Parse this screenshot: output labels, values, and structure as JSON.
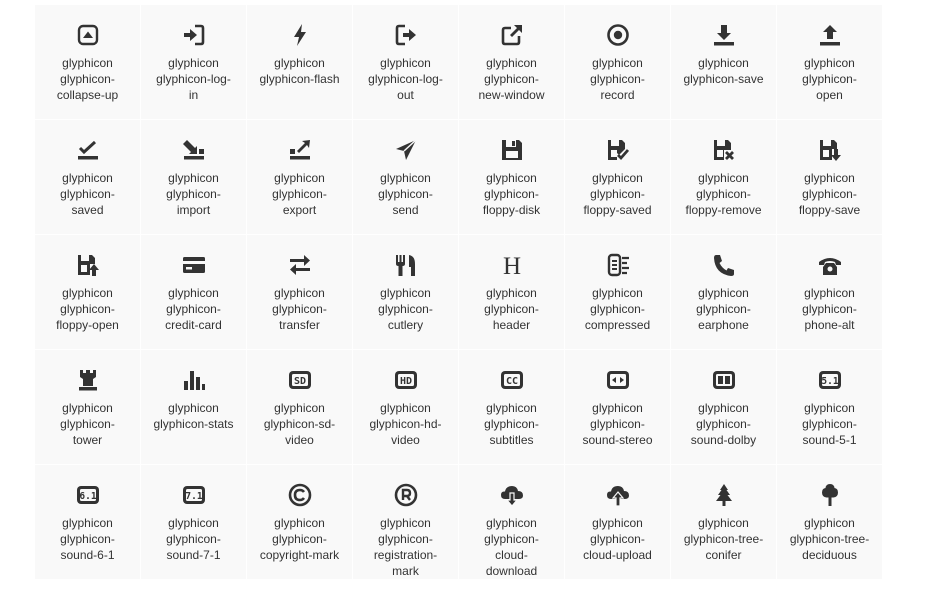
{
  "icons": [
    {
      "name": "collapse-up-icon",
      "lines": [
        "glyphicon",
        "glyphicon-",
        "collapse-up"
      ]
    },
    {
      "name": "log-in-icon",
      "lines": [
        "glyphicon",
        "glyphicon-log-",
        "in"
      ]
    },
    {
      "name": "flash-icon",
      "lines": [
        "glyphicon",
        "glyphicon-flash"
      ]
    },
    {
      "name": "log-out-icon",
      "lines": [
        "glyphicon",
        "glyphicon-log-",
        "out"
      ]
    },
    {
      "name": "new-window-icon",
      "lines": [
        "glyphicon",
        "glyphicon-",
        "new-window"
      ]
    },
    {
      "name": "record-icon",
      "lines": [
        "glyphicon",
        "glyphicon-",
        "record"
      ]
    },
    {
      "name": "save-icon",
      "lines": [
        "glyphicon",
        "glyphicon-save"
      ]
    },
    {
      "name": "open-icon",
      "lines": [
        "glyphicon",
        "glyphicon-",
        "open"
      ]
    },
    {
      "name": "saved-icon",
      "lines": [
        "glyphicon",
        "glyphicon-",
        "saved"
      ]
    },
    {
      "name": "import-icon",
      "lines": [
        "glyphicon",
        "glyphicon-",
        "import"
      ]
    },
    {
      "name": "export-icon",
      "lines": [
        "glyphicon",
        "glyphicon-",
        "export"
      ]
    },
    {
      "name": "send-icon",
      "lines": [
        "glyphicon",
        "glyphicon-",
        "send"
      ]
    },
    {
      "name": "floppy-disk-icon",
      "lines": [
        "glyphicon",
        "glyphicon-",
        "floppy-disk"
      ]
    },
    {
      "name": "floppy-saved-icon",
      "lines": [
        "glyphicon",
        "glyphicon-",
        "floppy-saved"
      ]
    },
    {
      "name": "floppy-remove-icon",
      "lines": [
        "glyphicon",
        "glyphicon-",
        "floppy-remove"
      ]
    },
    {
      "name": "floppy-save-icon",
      "lines": [
        "glyphicon",
        "glyphicon-",
        "floppy-save"
      ]
    },
    {
      "name": "floppy-open-icon",
      "lines": [
        "glyphicon",
        "glyphicon-",
        "floppy-open"
      ]
    },
    {
      "name": "credit-card-icon",
      "lines": [
        "glyphicon",
        "glyphicon-",
        "credit-card"
      ]
    },
    {
      "name": "transfer-icon",
      "lines": [
        "glyphicon",
        "glyphicon-",
        "transfer"
      ]
    },
    {
      "name": "cutlery-icon",
      "lines": [
        "glyphicon",
        "glyphicon-",
        "cutlery"
      ]
    },
    {
      "name": "header-icon",
      "lines": [
        "glyphicon",
        "glyphicon-",
        "header"
      ]
    },
    {
      "name": "compressed-icon",
      "lines": [
        "glyphicon",
        "glyphicon-",
        "compressed"
      ]
    },
    {
      "name": "earphone-icon",
      "lines": [
        "glyphicon",
        "glyphicon-",
        "earphone"
      ]
    },
    {
      "name": "phone-alt-icon",
      "lines": [
        "glyphicon",
        "glyphicon-",
        "phone-alt"
      ]
    },
    {
      "name": "tower-icon",
      "lines": [
        "glyphicon",
        "glyphicon-",
        "tower"
      ]
    },
    {
      "name": "stats-icon",
      "lines": [
        "glyphicon",
        "glyphicon-stats"
      ]
    },
    {
      "name": "sd-video-icon",
      "lines": [
        "glyphicon",
        "glyphicon-sd-",
        "video"
      ]
    },
    {
      "name": "hd-video-icon",
      "lines": [
        "glyphicon",
        "glyphicon-hd-",
        "video"
      ]
    },
    {
      "name": "subtitles-icon",
      "lines": [
        "glyphicon",
        "glyphicon-",
        "subtitles"
      ]
    },
    {
      "name": "sound-stereo-icon",
      "lines": [
        "glyphicon",
        "glyphicon-",
        "sound-stereo"
      ]
    },
    {
      "name": "sound-dolby-icon",
      "lines": [
        "glyphicon",
        "glyphicon-",
        "sound-dolby"
      ]
    },
    {
      "name": "sound-5-1-icon",
      "lines": [
        "glyphicon",
        "glyphicon-",
        "sound-5-1"
      ]
    },
    {
      "name": "sound-6-1-icon",
      "lines": [
        "glyphicon",
        "glyphicon-",
        "sound-6-1"
      ]
    },
    {
      "name": "sound-7-1-icon",
      "lines": [
        "glyphicon",
        "glyphicon-",
        "sound-7-1"
      ]
    },
    {
      "name": "copyright-mark-icon",
      "lines": [
        "glyphicon",
        "glyphicon-",
        "copyright-mark"
      ]
    },
    {
      "name": "registration-mark-icon",
      "lines": [
        "glyphicon",
        "glyphicon-",
        "registration-",
        "mark"
      ]
    },
    {
      "name": "cloud-download-icon",
      "lines": [
        "glyphicon",
        "glyphicon-",
        "cloud-",
        "download"
      ]
    },
    {
      "name": "cloud-upload-icon",
      "lines": [
        "glyphicon",
        "glyphicon-",
        "cloud-upload"
      ]
    },
    {
      "name": "tree-conifer-icon",
      "lines": [
        "glyphicon",
        "glyphicon-tree-",
        "conifer"
      ]
    },
    {
      "name": "tree-deciduous-icon",
      "lines": [
        "glyphicon",
        "glyphicon-tree-",
        "deciduous"
      ]
    }
  ]
}
